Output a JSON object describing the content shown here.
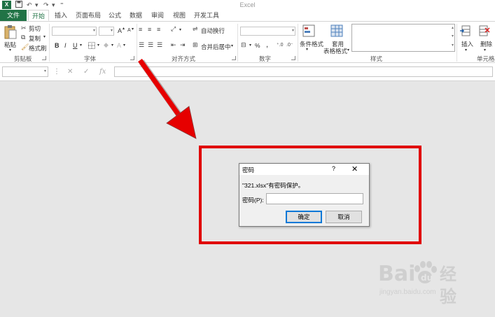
{
  "app": {
    "title": "Excel",
    "logo": "X"
  },
  "qat": {
    "save_icon": "save-icon",
    "undo_icon": "undo-icon",
    "redo_icon": "redo-icon"
  },
  "tabs": {
    "file": "文件",
    "items": [
      "开始",
      "插入",
      "页面布局",
      "公式",
      "数据",
      "审阅",
      "视图",
      "开发工具"
    ]
  },
  "ribbon": {
    "clipboard": {
      "paste": "粘贴",
      "cut": "剪切",
      "copy": "复制",
      "format_painter": "格式刷",
      "label": "剪贴板"
    },
    "font": {
      "bold": "B",
      "italic": "I",
      "underline": "U",
      "grow": "A",
      "shrink": "A",
      "label": "字体"
    },
    "alignment": {
      "wrap": "自动换行",
      "merge": "合并后居中",
      "label": "对齐方式"
    },
    "number": {
      "percent": "%",
      "comma": ",",
      "label": "数字"
    },
    "styles": {
      "conditional": "条件格式",
      "table_format_line1": "套用",
      "table_format_line2": "表格格式",
      "label": "样式"
    },
    "cells": {
      "insert": "插入",
      "delete": "删除",
      "label": "单元格"
    }
  },
  "formula_bar": {
    "cancel": "✕",
    "enter": "✓",
    "fx": "fx"
  },
  "dialog": {
    "title": "密码",
    "help": "?",
    "close": "✕",
    "message": "\"321.xlsx\"有密码保护。",
    "password_label": "密码(P):",
    "password_value": "",
    "ok": "确定",
    "cancel": "取消"
  },
  "watermark": {
    "brand": "Bai",
    "brand2": "经验",
    "url": "jingyan.baidu.com"
  },
  "colors": {
    "excel_green": "#217346",
    "highlight_red": "#e00000",
    "arrow_red": "#e60000"
  }
}
